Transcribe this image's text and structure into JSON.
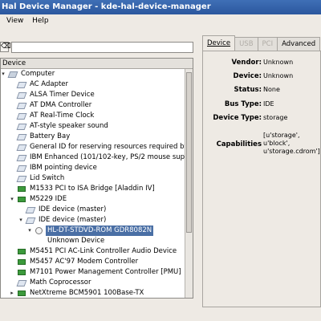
{
  "window": {
    "title": "Hal Device Manager - kde-hal-device-manager"
  },
  "menu": [
    "View",
    "Help"
  ],
  "search": {
    "clear_icon": "clear-text-icon",
    "value": ""
  },
  "tree": {
    "header": "Device",
    "rows": [
      {
        "label": "Computer",
        "depth": 0,
        "expander": "open",
        "icon": "computer"
      },
      {
        "label": "AC Adapter",
        "depth": 1,
        "icon": "device"
      },
      {
        "label": "ALSA Timer Device",
        "depth": 1,
        "icon": "device"
      },
      {
        "label": "AT DMA Controller",
        "depth": 1,
        "icon": "device"
      },
      {
        "label": "AT Real-Time Clock",
        "depth": 1,
        "icon": "device"
      },
      {
        "label": "AT-style speaker sound",
        "depth": 1,
        "icon": "device"
      },
      {
        "label": "Battery Bay",
        "depth": 1,
        "icon": "device"
      },
      {
        "label": "General ID for reserving resources required by PnP",
        "depth": 1,
        "icon": "device"
      },
      {
        "label": "IBM Enhanced (101/102-key, PS/2 mouse support)",
        "depth": 1,
        "icon": "device"
      },
      {
        "label": "IBM pointing device",
        "depth": 1,
        "icon": "device"
      },
      {
        "label": "Lid Switch",
        "depth": 1,
        "icon": "device"
      },
      {
        "label": "M1533 PCI to ISA Bridge [Aladdin IV]",
        "depth": 1,
        "icon": "card"
      },
      {
        "label": "M5229 IDE",
        "depth": 1,
        "expander": "open",
        "icon": "card"
      },
      {
        "label": "IDE device (master)",
        "depth": 2,
        "icon": "device"
      },
      {
        "label": "IDE device (master)",
        "depth": 2,
        "expander": "open",
        "icon": "device"
      },
      {
        "label": "HL-DT-STDVD-ROM GDR8082N",
        "depth": 3,
        "expander": "open",
        "icon": "disc",
        "selected": true
      },
      {
        "label": "Unknown Device",
        "depth": 4,
        "icon": "none"
      },
      {
        "label": "M5451 PCI AC-Link Controller Audio Device",
        "depth": 1,
        "icon": "card"
      },
      {
        "label": "M5457 AC'97 Modem Controller",
        "depth": 1,
        "icon": "card"
      },
      {
        "label": "M7101 Power Management Controller [PMU]",
        "depth": 1,
        "icon": "card"
      },
      {
        "label": "Math Coprocessor",
        "depth": 1,
        "icon": "device"
      },
      {
        "label": "NetXtreme BCM5901 100Base-TX",
        "depth": 1,
        "expander": "closed",
        "icon": "card"
      }
    ]
  },
  "tabs": [
    {
      "label": "Device",
      "state": "active"
    },
    {
      "label": "USB",
      "state": "disabled"
    },
    {
      "label": "PCI",
      "state": "disabled"
    },
    {
      "label": "Advanced",
      "state": "enabled"
    }
  ],
  "properties": [
    {
      "key": "Vendor:",
      "value": "Unknown"
    },
    {
      "key": "Device:",
      "value": "Unknown"
    },
    {
      "key": "Status:",
      "value": "None"
    },
    {
      "key": "Bus Type:",
      "value": "IDE"
    },
    {
      "key": "Device Type:",
      "value": "storage"
    },
    {
      "key": "Capabilities",
      "value": [
        "[u'storage',",
        "u'block',",
        "u'storage.cdrom']"
      ]
    }
  ]
}
